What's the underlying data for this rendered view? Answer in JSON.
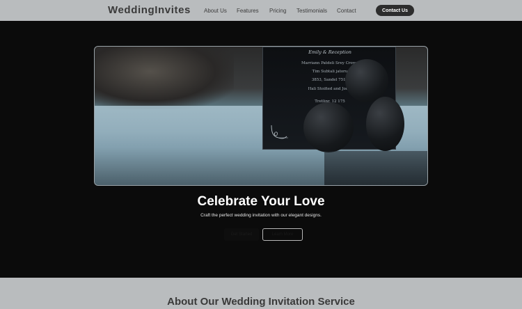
{
  "header": {
    "brand": "WeddingInvites",
    "nav": [
      "About Us",
      "Features",
      "Pricing",
      "Testimonials",
      "Contact"
    ],
    "cta": "Contact Us"
  },
  "hero": {
    "image_icon": "wedding-invitation-photo",
    "card_lines": [
      "Emily & Reception",
      "Marriann Patdeli Srey Crown",
      "Tim Subtali jatoru",
      "3853, Sandel 7513",
      "Hali Stoified and Jooty",
      "Tretlinr. 12 175",
      "Pinseedir (…"
    ],
    "title": "Celebrate Your Love",
    "subtitle": "Craft the perfect wedding invitation with our elegant designs.",
    "primary_button": "Get Started",
    "secondary_button": "Learn More"
  },
  "about": {
    "title": "About Our Wedding Invitation Service"
  },
  "colors": {
    "header_bg": "#b9bcbe",
    "hero_bg": "#0b0b0b",
    "cta_bg": "#2d2d2d"
  }
}
